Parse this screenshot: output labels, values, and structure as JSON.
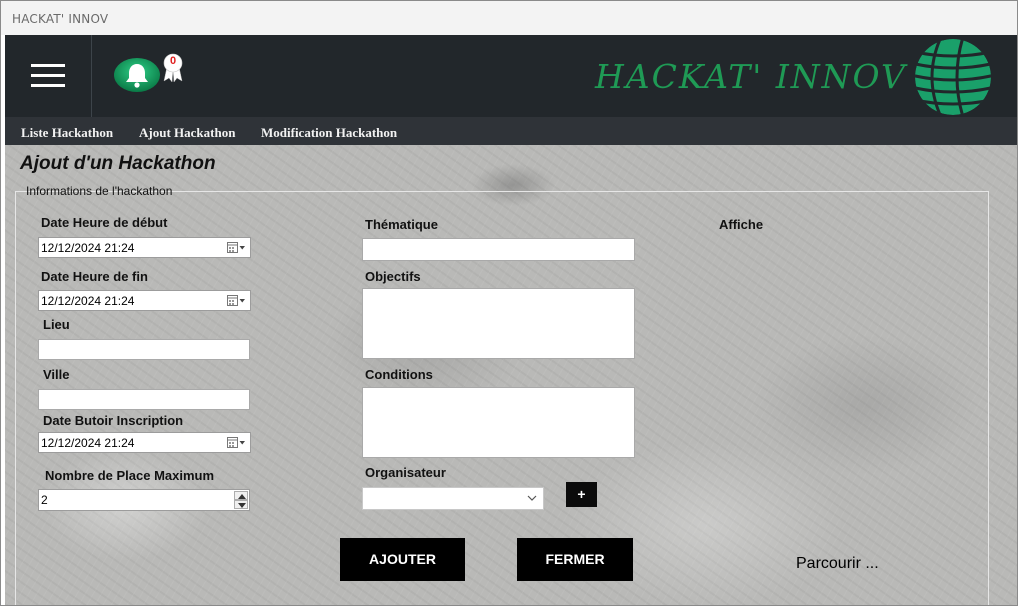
{
  "window": {
    "title": "HACKAT' INNOV"
  },
  "header": {
    "brand": "HACKAT' INNOV",
    "notification_count": "0",
    "colors": {
      "header_bg": "#22272b",
      "brand": "#1f9a55",
      "bell": "#14a062",
      "badge": "#e02020"
    }
  },
  "menu": {
    "items": [
      {
        "label": "Liste Hackathon"
      },
      {
        "label": "Ajout Hackathon"
      },
      {
        "label": "Modification Hackathon"
      }
    ]
  },
  "page": {
    "title": "Ajout d'un Hackathon",
    "group_label": "Informations de l'hackathon"
  },
  "form": {
    "date_debut_label": "Date Heure de début",
    "date_debut_value": "12/12/2024 21:24",
    "date_fin_label": "Date Heure de fin",
    "date_fin_value": "12/12/2024 21:24",
    "lieu_label": "Lieu",
    "lieu_value": "",
    "ville_label": "Ville",
    "ville_value": "",
    "date_butoir_label": "Date Butoir Inscription",
    "date_butoir_value": "12/12/2024 21:24",
    "places_label": "Nombre de Place Maximum",
    "places_value": "2",
    "thematique_label": "Thématique",
    "thematique_value": "",
    "objectifs_label": "Objectifs",
    "objectifs_value": "",
    "conditions_label": "Conditions",
    "conditions_value": "",
    "organisateur_label": "Organisateur",
    "organisateur_value": "",
    "add_organisateur_label": "+",
    "affiche_label": "Affiche",
    "parcourir_label": "Parcourir ..."
  },
  "actions": {
    "ajouter_label": "AJOUTER",
    "fermer_label": "FERMER"
  }
}
